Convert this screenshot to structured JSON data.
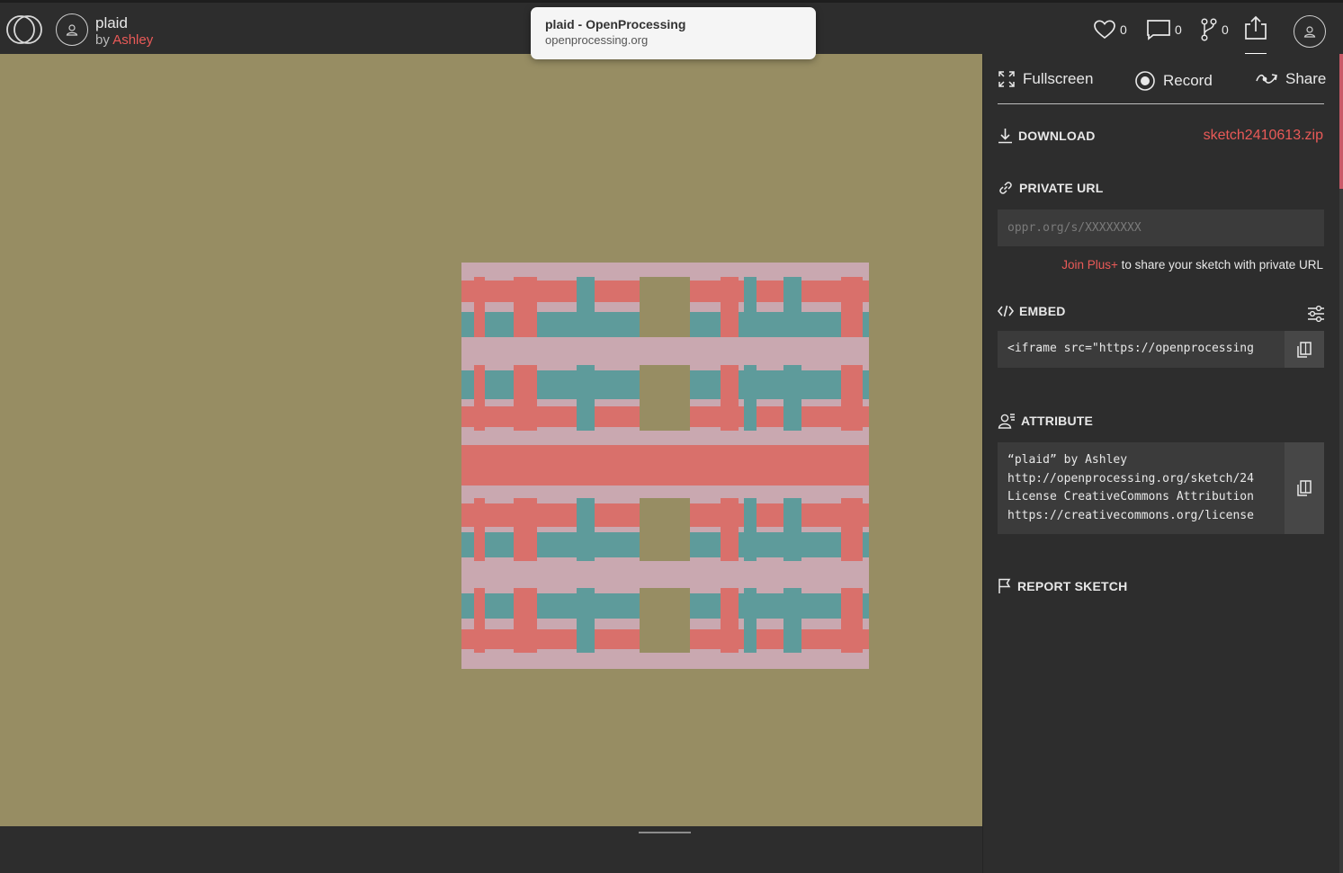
{
  "header": {
    "sketch_title": "plaid",
    "by_prefix": "by",
    "author": "Ashley",
    "stats": {
      "likes": "0",
      "comments": "0",
      "forks": "0"
    }
  },
  "tooltip": {
    "title": "plaid - OpenProcessing",
    "url": "openprocessing.org"
  },
  "canvas": {
    "background": "#978d63",
    "plaid_colors": {
      "light": "#c9a8b0",
      "coral": "#d9706b",
      "teal": "#5e9b9b",
      "khaki": "#978d63"
    }
  },
  "panel": {
    "tabs": {
      "fullscreen": "Fullscreen",
      "record": "Record",
      "share": "Share"
    },
    "download": {
      "label": "DOWNLOAD",
      "file": "sketch2410613.zip"
    },
    "private_url": {
      "label": "PRIVATE URL",
      "placeholder": "oppr.org/s/XXXXXXXX",
      "join_link": "Join Plus+",
      "join_text": " to share your sketch with private URL"
    },
    "embed": {
      "label": "EMBED",
      "code": "<iframe src=\"https://openprocessing"
    },
    "attribute": {
      "label": "ATTRIBUTE",
      "lines": [
        "“plaid” by Ashley",
        "http://openprocessing.org/sketch/24",
        "License CreativeCommons Attribution",
        "https://creativecommons.org/license"
      ]
    },
    "report": {
      "label": "REPORT SKETCH"
    }
  },
  "colors": {
    "accent": "#ea5a58",
    "bar": "#2d2d2d",
    "field": "#3b3b3b"
  }
}
